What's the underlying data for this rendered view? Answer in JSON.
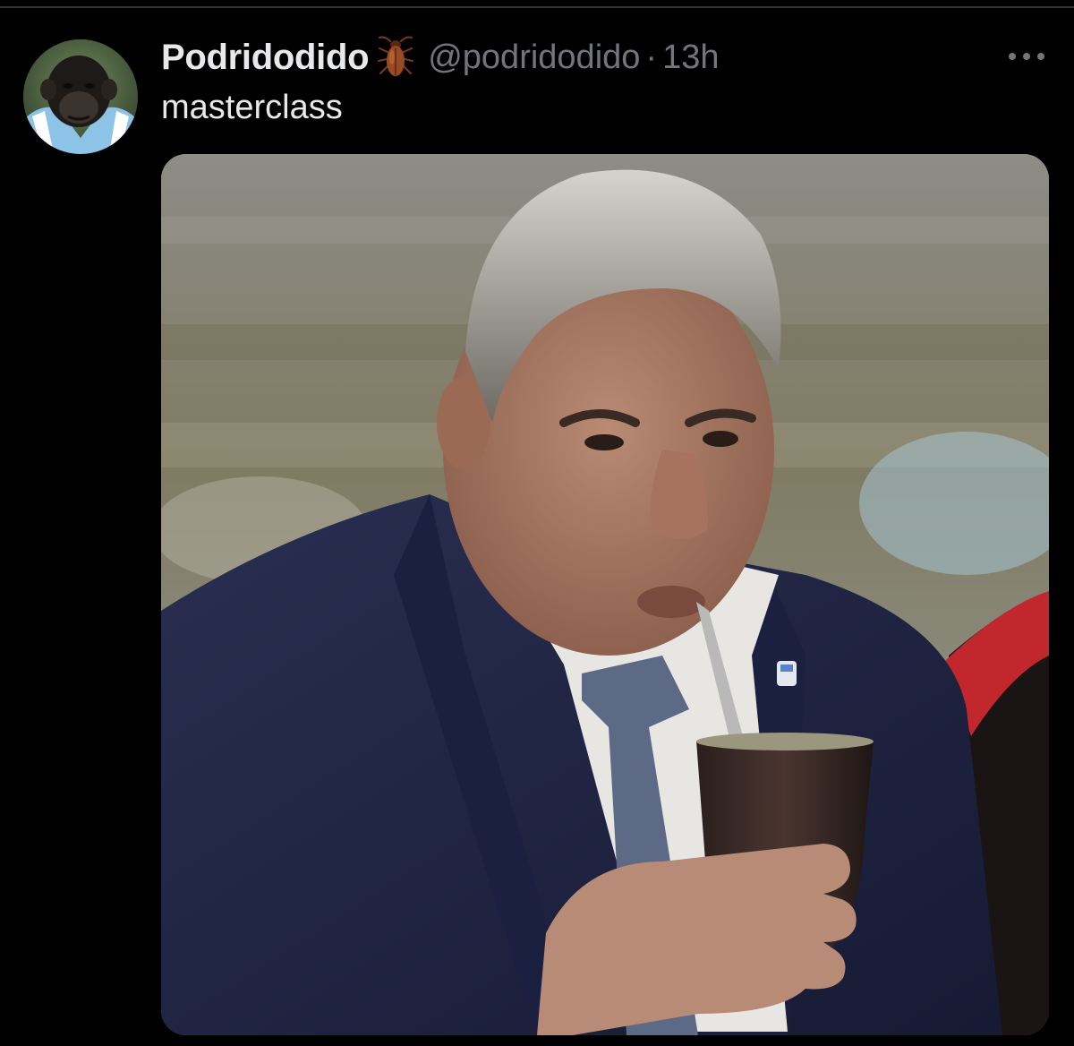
{
  "tweet": {
    "display_name": "Podridodido",
    "name_emoji_icon": "cockroach-emoji-icon",
    "handle": "@podridodido",
    "separator": "·",
    "timestamp": "13h",
    "text": "masterclass",
    "more_icon": "more-horizontal-icon"
  },
  "colors": {
    "background": "#000000",
    "primary_text": "#e7e9ea",
    "secondary_text": "#71767b",
    "divider": "#2f3336"
  }
}
